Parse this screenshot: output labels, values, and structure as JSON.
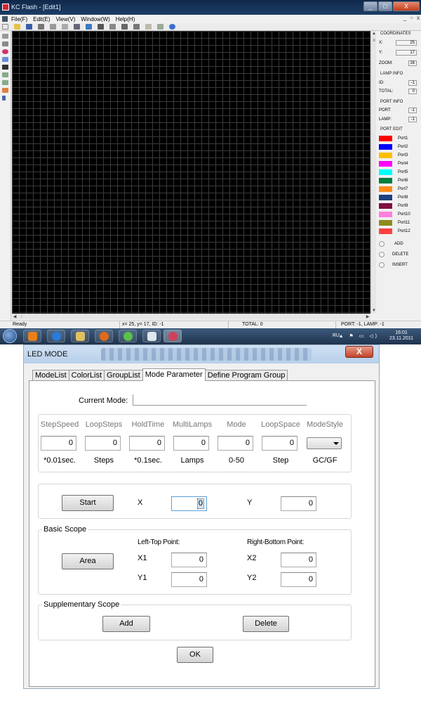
{
  "app": {
    "title": "KC Flash - [Edit1]",
    "menu": [
      "File(F)",
      "Edit(E)",
      "View(V)",
      "Window(W)",
      "Help(H)"
    ],
    "win_buttons": {
      "minimize": "_",
      "maximize": "□",
      "close": "X"
    },
    "mdi_buttons": {
      "minimize": "_",
      "restore": "▫",
      "close": "x"
    }
  },
  "panel": {
    "coordinates": {
      "title": "COORDINATES",
      "x_label": "X:",
      "x": "25",
      "y_label": "Y:",
      "y": "17",
      "zoom_label": "ZOOM:",
      "zoom": "16"
    },
    "lamp_info": {
      "title": "LAMP INFO",
      "id_label": "ID:",
      "id": "-1",
      "total_label": "TOTAL:",
      "total": "0"
    },
    "port_info": {
      "title": "PORT INFO",
      "port_label": "PORT:",
      "port": "-1",
      "lamp_label": "LAMP:",
      "lamp": "-1"
    },
    "port_edit": {
      "title": "PORT EDIT",
      "ports": [
        {
          "label": "Port1",
          "color": "#ff0000"
        },
        {
          "label": "Port2",
          "color": "#0000ff"
        },
        {
          "label": "Port3",
          "color": "#ffbf00"
        },
        {
          "label": "Port4",
          "color": "#ff00ff"
        },
        {
          "label": "Port5",
          "color": "#00ffff"
        },
        {
          "label": "Port6",
          "color": "#007f3f"
        },
        {
          "label": "Port7",
          "color": "#ff8c1a"
        },
        {
          "label": "Port8",
          "color": "#1f3f7f"
        },
        {
          "label": "Port9",
          "color": "#7f0f3f"
        },
        {
          "label": "Port10",
          "color": "#ff7fdf"
        },
        {
          "label": "Port11",
          "color": "#8c8c1a"
        },
        {
          "label": "Port12",
          "color": "#ff4040"
        }
      ],
      "actions": [
        "ADD",
        "DELETE",
        "INSERT"
      ]
    }
  },
  "status": {
    "ready": "Ready",
    "coords": "x=   25,   y=   17,   ID:   -1",
    "total": "TOTAL:    0",
    "port_lamp": "PORT:  -1, LAMP:   -1"
  },
  "taskbar": {
    "lang": "RU",
    "time": "16:01",
    "date": "23.11.2011"
  },
  "dialog": {
    "title": "LED MODE",
    "close": "X",
    "tabs": [
      "ModeList",
      "ColorList",
      "GroupList",
      "Mode Parameter",
      "Define Program Group"
    ],
    "active_tab": "Mode Parameter",
    "current_mode_label": "Current Mode:",
    "current_mode_value": "",
    "params": [
      {
        "head": "StepSpeed",
        "value": "0",
        "unit": "*0.01sec."
      },
      {
        "head": "LoopSteps",
        "value": "0",
        "unit": "Steps"
      },
      {
        "head": "HoldTime",
        "value": "0",
        "unit": "*0.1sec."
      },
      {
        "head": "MultiLamps",
        "value": "0",
        "unit": "Lamps"
      },
      {
        "head": "Mode",
        "value": "0",
        "unit": "0-50"
      },
      {
        "head": "LoopSpace",
        "value": "0",
        "unit": "Step"
      },
      {
        "head": "ModeStyle",
        "value": "",
        "unit": "GC/GF"
      }
    ],
    "start": {
      "button": "Start",
      "x_label": "X",
      "x_value": "0",
      "y_label": "Y",
      "y_value": "0"
    },
    "basic_scope": {
      "title": "Basic Scope",
      "area_button": "Area",
      "left_top": "Left-Top Point:",
      "right_bottom": "Right-Bottom Point:",
      "x1_label": "X1",
      "x1": "0",
      "y1_label": "Y1",
      "y1": "0",
      "x2_label": "X2",
      "x2": "0",
      "y2_label": "Y2",
      "y2": "0"
    },
    "supplementary_scope": {
      "title": "Supplementary Scope",
      "add": "Add",
      "delete": "Delete"
    },
    "ok": "OK"
  }
}
